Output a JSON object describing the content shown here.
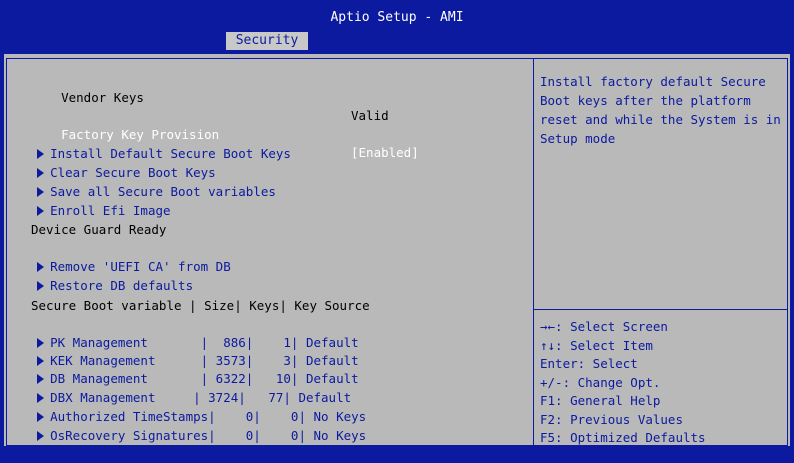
{
  "header": {
    "title": "Aptio Setup - AMI",
    "active_tab": "Security"
  },
  "settings": {
    "vendor_keys_label": "Vendor Keys",
    "vendor_keys_value": "Valid",
    "factory_key_label": "Factory Key Provision",
    "factory_key_value": "[Enabled]"
  },
  "submenus_a": [
    "Install Default Secure Boot Keys",
    "Clear Secure Boot Keys",
    "Save all Secure Boot variables",
    "Enroll Efi Image"
  ],
  "device_guard_label": "Device Guard Ready",
  "submenus_b": [
    "Remove 'UEFI CA' from DB",
    "Restore DB defaults"
  ],
  "table_header": "Secure Boot variable | Size| Keys| Key Source",
  "table_rows": [
    "PK Management       |  886|    1| Default",
    "KEK Management      | 3573|    3| Default",
    "DB Management       | 6322|   10| Default",
    "DBX Management     | 3724|   77| Default",
    "Authorized TimeStamps|    0|    0| No Keys",
    "OsRecovery Signatures|    0|    0| No Keys"
  ],
  "help_text": "Install factory default Secure Boot keys after the platform reset and while the System is in Setup mode",
  "key_help": [
    "→←: Select Screen",
    "↑↓: Select Item",
    "Enter: Select",
    "+/-: Change Opt.",
    "F1: General Help",
    "F2: Previous Values",
    "F5: Optimized Defaults"
  ],
  "colors": {
    "background": "#0b1a9e",
    "panel": "#b9b9b9",
    "selected_text": "#ffffff",
    "submenu_text": "#0b1a9e"
  }
}
